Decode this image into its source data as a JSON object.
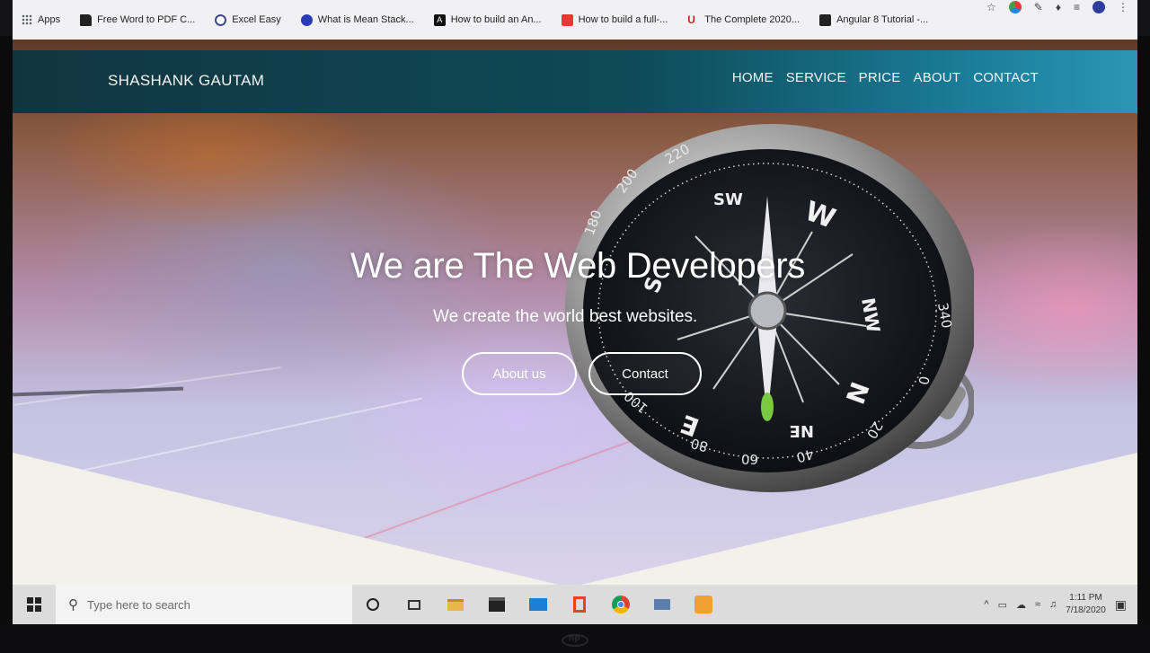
{
  "browser": {
    "bookmarks": [
      {
        "label": "Apps",
        "icon": "apps-grid-icon",
        "color": "#5f6368"
      },
      {
        "label": "Free Word to PDF C...",
        "icon": "pdf-doc-icon",
        "color": "#222222"
      },
      {
        "label": "Excel Easy",
        "icon": "excel-easy-icon",
        "color": "#3c4a8a"
      },
      {
        "label": "What is Mean Stack...",
        "icon": "blue-circle-icon",
        "color": "#2a3bb7"
      },
      {
        "label": "How to build an An...",
        "icon": "angular-a-icon",
        "color": "#111111"
      },
      {
        "label": "How to build a full-...",
        "icon": "red-square-icon",
        "color": "#e53935"
      },
      {
        "label": "The Complete 2020...",
        "icon": "udemy-u-icon",
        "color": "#c62828"
      },
      {
        "label": "Angular 8 Tutorial -...",
        "icon": "dark-tile-icon",
        "color": "#222222"
      }
    ]
  },
  "site": {
    "brand": "SHASHANK GAUTAM",
    "nav": [
      "HOME",
      "SERVICE",
      "PRICE",
      "ABOUT",
      "CONTACT"
    ],
    "hero": {
      "title": "We are The Web Developers",
      "subtitle": "We create the world best websites.",
      "button_about": "About us",
      "button_contact": "Contact"
    },
    "compass_labels": {
      "sw": "SW",
      "w": "W",
      "s": "S",
      "nw": "NW",
      "n": "N",
      "e": "E",
      "ne": "NE",
      "deg200": "200",
      "deg180": "180",
      "deg220": "220",
      "deg340": "340",
      "deg0": "0",
      "deg20": "20",
      "deg40": "40",
      "deg60": "60",
      "deg80": "80",
      "deg100": "100"
    },
    "colors": {
      "navbar_start": "#11353f",
      "navbar_end": "#2b96b4",
      "section_white": "#f2f1ea"
    }
  },
  "taskbar": {
    "search_placeholder": "Type here to search",
    "time": "1:11 PM",
    "date": "7/18/2020"
  }
}
